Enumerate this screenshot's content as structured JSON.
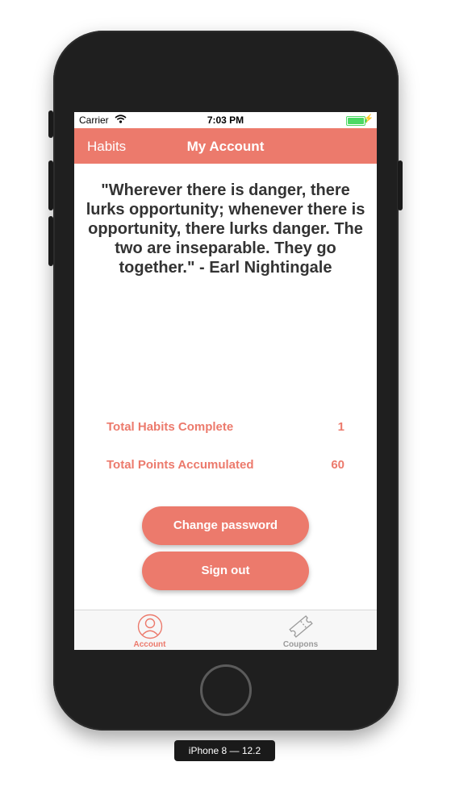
{
  "status_bar": {
    "carrier": "Carrier",
    "time": "7:03 PM"
  },
  "nav": {
    "back_label": "Habits",
    "title": "My Account"
  },
  "quote": "\"Wherever there is danger, there lurks opportunity; whenever there is opportunity, there lurks danger. The two are inseparable. They go together.\" - Earl Nightingale",
  "stats": [
    {
      "label": "Total Habits Complete",
      "value": "1"
    },
    {
      "label": "Total Points Accumulated",
      "value": "60"
    }
  ],
  "buttons": {
    "change_password": "Change password",
    "sign_out": "Sign out"
  },
  "tabs": [
    {
      "label": "Account",
      "icon": "person-circle-icon",
      "active": true
    },
    {
      "label": "Coupons",
      "icon": "ticket-icon",
      "active": false
    }
  ],
  "device_label": "iPhone 8 — 12.2",
  "colors": {
    "accent": "#ec7a6c",
    "quote_text": "#333333",
    "inactive_tab": "#9a9a9a"
  }
}
